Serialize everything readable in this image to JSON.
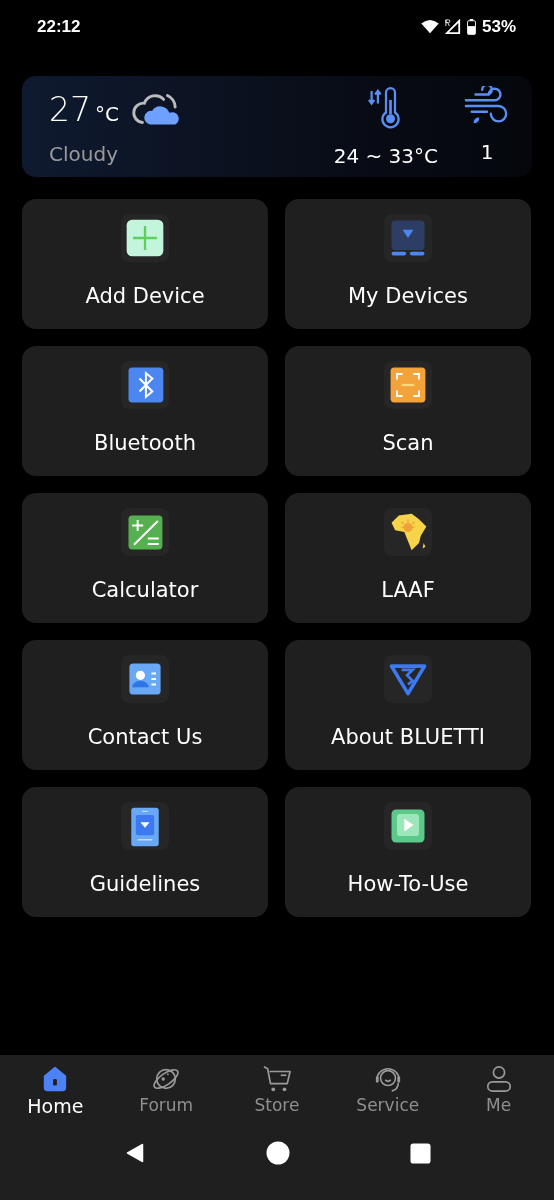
{
  "status_bar": {
    "time": "22:12",
    "battery": "53%"
  },
  "weather": {
    "temperature": "27",
    "unit": "°C",
    "condition": "Cloudy",
    "range": "24 ~ 33°C",
    "wind": "1"
  },
  "tiles": [
    {
      "label": "Add Device"
    },
    {
      "label": "My Devices"
    },
    {
      "label": "Bluetooth"
    },
    {
      "label": "Scan"
    },
    {
      "label": "Calculator"
    },
    {
      "label": "LAAF"
    },
    {
      "label": "Contact Us"
    },
    {
      "label": "About BLUETTI"
    },
    {
      "label": "Guidelines"
    },
    {
      "label": "How-To-Use"
    }
  ],
  "bottom_nav": [
    {
      "label": "Home",
      "selected": true
    },
    {
      "label": "Forum",
      "selected": false
    },
    {
      "label": "Store",
      "selected": false
    },
    {
      "label": "Service",
      "selected": false
    },
    {
      "label": "Me",
      "selected": false
    }
  ]
}
